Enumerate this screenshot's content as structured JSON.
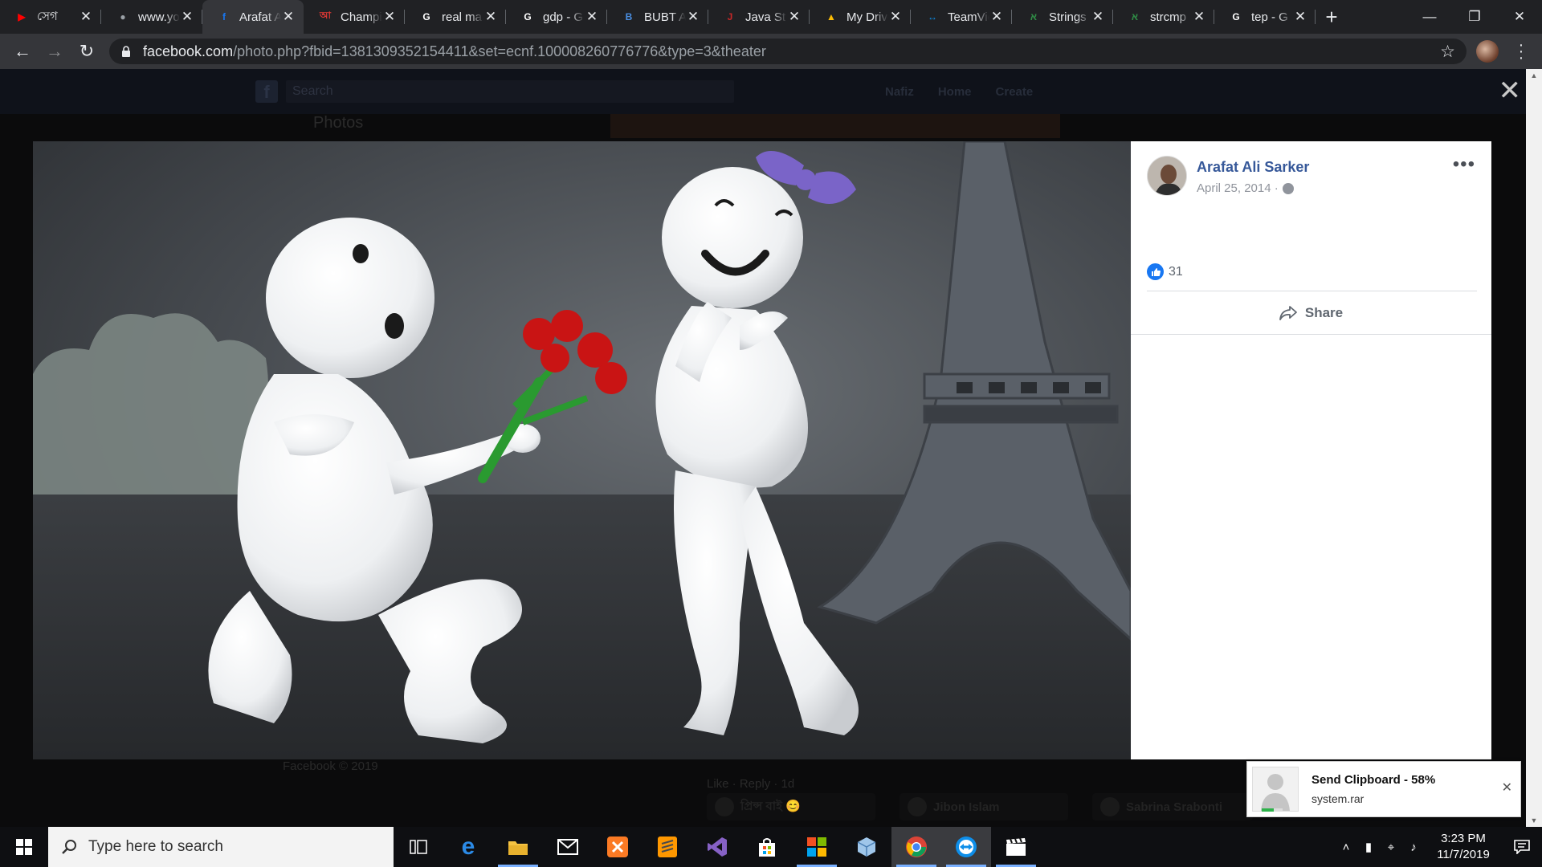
{
  "browser": {
    "tabs": [
      {
        "title": "সেগ",
        "icon": "youtube-icon",
        "color": "#ff0000",
        "active": false
      },
      {
        "title": "www.yo",
        "icon": "globe-icon",
        "color": "#9aa0a6",
        "active": false
      },
      {
        "title": "Arafat Ali",
        "icon": "facebook-icon",
        "color": "#1877f2",
        "active": true
      },
      {
        "title": "Champion",
        "icon": "news-icon",
        "color": "#e53935",
        "active": false
      },
      {
        "title": "real ma",
        "icon": "google-icon",
        "color": "#ffffff",
        "active": false
      },
      {
        "title": "gdp - G",
        "icon": "google-icon",
        "color": "#ffffff",
        "active": false
      },
      {
        "title": "BUBT A",
        "icon": "bubt-icon",
        "color": "#4a8fe2",
        "active": false
      },
      {
        "title": "Java St",
        "icon": "java-icon",
        "color": "#c62828",
        "active": false
      },
      {
        "title": "My Drive",
        "icon": "drive-icon",
        "color": "#fbbc04",
        "active": false
      },
      {
        "title": "TeamViewer",
        "icon": "teamviewer-icon",
        "color": "#0e8ee9",
        "active": false
      },
      {
        "title": "Strings",
        "icon": "gfg-icon",
        "color": "#2f8d46",
        "active": false
      },
      {
        "title": "strcmp",
        "icon": "gfg-icon",
        "color": "#2f8d46",
        "active": false
      },
      {
        "title": "tep - G",
        "icon": "google-icon",
        "color": "#ffffff",
        "active": false
      }
    ],
    "url_host": "facebook.com",
    "url_path": "/photo.php?fbid=1381309352154411&set=ecnf.100008260776776&type=3&theater"
  },
  "fb": {
    "search_placeholder": "Search",
    "nav": [
      "Nafiz",
      "Home",
      "Create"
    ],
    "photos_label": "Photos"
  },
  "post": {
    "author": "Arafat Ali Sarker",
    "date": "April 25, 2014 · ",
    "likes": "31",
    "share_label": "Share",
    "more_label": "•••"
  },
  "background": {
    "footer": "Facebook © 2019",
    "like_reply": "Like · Reply · 1d",
    "chips": [
      "প্রিন্স বাই 😊",
      "Jibon Islam",
      "Sabrina Srabonti"
    ]
  },
  "toast": {
    "title": "Send Clipboard - 58%",
    "subtitle": "system.rar",
    "progress": 0.58
  },
  "taskbar": {
    "search_placeholder": "Type here to search",
    "time": "3:23 PM",
    "date": "11/7/2019"
  }
}
